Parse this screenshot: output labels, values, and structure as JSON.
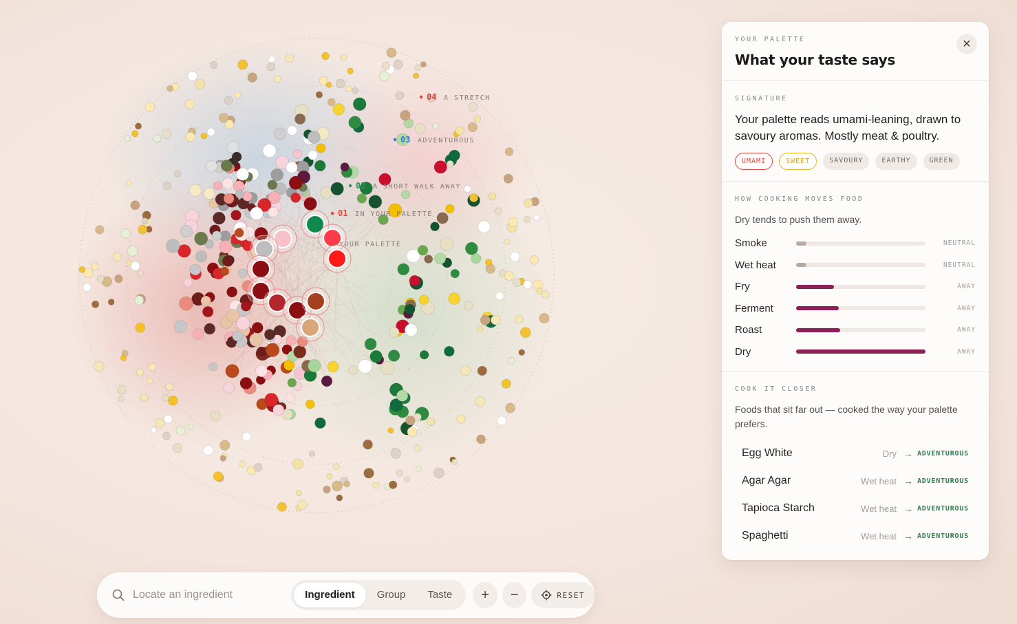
{
  "map": {
    "ring_labels": [
      {
        "num": "01",
        "text": "IN YOUR PALETTE",
        "color": "#e0473c"
      },
      {
        "num": "02",
        "text": "A SHORT WALK AWAY",
        "color": "#2f8f56"
      },
      {
        "num": "03",
        "text": "ADVENTUROUS",
        "color": "#3a7bd5"
      },
      {
        "num": "04",
        "text": "A STRETCH",
        "color": "#d9413a"
      }
    ],
    "center_label": "YOUR PALETTE"
  },
  "panel": {
    "eyebrow": "YOUR PALETTE",
    "title": "What your taste says",
    "close_icon": "close-icon",
    "signature": {
      "eyebrow": "SIGNATURE",
      "text": "Your palette reads umami-leaning, drawn to savoury aromas. Mostly meat & poultry.",
      "chips": [
        "UMAMI",
        "SWEET",
        "SAVOURY",
        "EARTHY",
        "GREEN"
      ]
    },
    "cooking": {
      "eyebrow": "HOW COOKING MOVES FOOD",
      "desc": "Dry tends to push them away.",
      "rows": [
        {
          "name": "Smoke",
          "level": 0.08,
          "tag": "NEUTRAL",
          "color": "#b6aaa5"
        },
        {
          "name": "Wet heat",
          "level": 0.08,
          "tag": "NEUTRAL",
          "color": "#b6aaa5"
        },
        {
          "name": "Fry",
          "level": 0.29,
          "tag": "AWAY",
          "color": "#8c1f55"
        },
        {
          "name": "Ferment",
          "level": 0.33,
          "tag": "AWAY",
          "color": "#8c1f55"
        },
        {
          "name": "Roast",
          "level": 0.34,
          "tag": "AWAY",
          "color": "#8c1f55"
        },
        {
          "name": "Dry",
          "level": 1.0,
          "tag": "AWAY",
          "color": "#8c1f55"
        }
      ]
    },
    "cook_closer": {
      "eyebrow": "COOK IT CLOSER",
      "desc": "Foods that sit far out — cooked the way your palette prefers.",
      "items": [
        {
          "name": "Egg White",
          "method": "Dry",
          "arrow": "→",
          "target": "ADVENTUROUS"
        },
        {
          "name": "Agar Agar",
          "method": "Wet heat",
          "arrow": "→",
          "target": "ADVENTUROUS"
        },
        {
          "name": "Tapioca Starch",
          "method": "Wet heat",
          "arrow": "→",
          "target": "ADVENTUROUS"
        },
        {
          "name": "Spaghetti",
          "method": "Wet heat",
          "arrow": "→",
          "target": "ADVENTUROUS"
        }
      ]
    }
  },
  "toolbar": {
    "search_placeholder": "Locate an ingredient",
    "search_icon": "search-icon",
    "modes": [
      "Ingredient",
      "Group",
      "Taste"
    ],
    "active_mode": "Ingredient",
    "zoom_in": "+",
    "zoom_out": "−",
    "reset_label": "RESET",
    "reset_icon": "crosshair-icon"
  },
  "colors": {
    "accent": "#8c1f55",
    "umami": "#e0473c",
    "sweet": "#f0b323",
    "adventurous": "#2f7d4b"
  }
}
